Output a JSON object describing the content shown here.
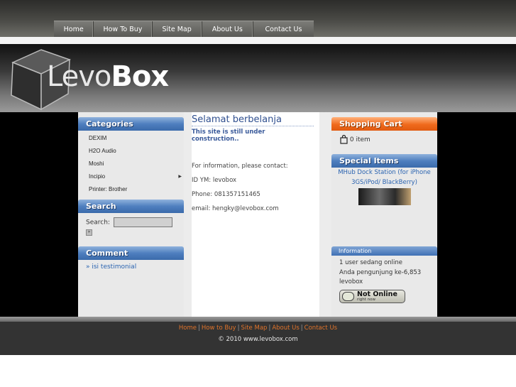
{
  "nav": {
    "items": [
      {
        "label": "Home"
      },
      {
        "label": "How To Buy"
      },
      {
        "label": "Site Map"
      },
      {
        "label": "About Us"
      },
      {
        "label": "Contact Us"
      }
    ]
  },
  "logo": {
    "part1": "Levo",
    "part2": "Box"
  },
  "categories": {
    "title": "Categories",
    "items": [
      {
        "label": "DEXIM"
      },
      {
        "label": "H2O Audio"
      },
      {
        "label": "Moshi"
      },
      {
        "label": "Incipio"
      },
      {
        "label": "Printer: Brother"
      }
    ]
  },
  "search": {
    "title": "Search",
    "label": "Search:",
    "value": "",
    "button": "»"
  },
  "comment": {
    "title": "Comment",
    "link": "» isi testimonial"
  },
  "main": {
    "title": "Selamat berbelanja",
    "subtitle": "This site is still under construction..",
    "lines": [
      "For information, please contact:",
      "ID YM: levobox",
      "Phone: 081357151465",
      "email: hengky@levobox.com"
    ]
  },
  "cart": {
    "title": "Shopping Cart",
    "count_text": "0 item"
  },
  "special": {
    "title": "Special Items",
    "product": "MHub Dock Station (for iPhone 3GS/iPod/ BlackBerry)"
  },
  "information": {
    "title": "Information",
    "lines": [
      "1 user sedang online",
      "Anda pengunjung ke-6,853",
      "levobox"
    ],
    "badge_main": "Not Online",
    "badge_sub": "right now"
  },
  "footer": {
    "links": [
      {
        "label": "Home"
      },
      {
        "label": "How to Buy"
      },
      {
        "label": "Site Map"
      },
      {
        "label": "About Us"
      },
      {
        "label": "Contact Us"
      }
    ],
    "copyright": "© 2010 www.levobox.com"
  },
  "colors": {
    "accent_blue": "#4f7fbf",
    "accent_orange": "#f06a1c",
    "footer_link": "#e0732a"
  }
}
